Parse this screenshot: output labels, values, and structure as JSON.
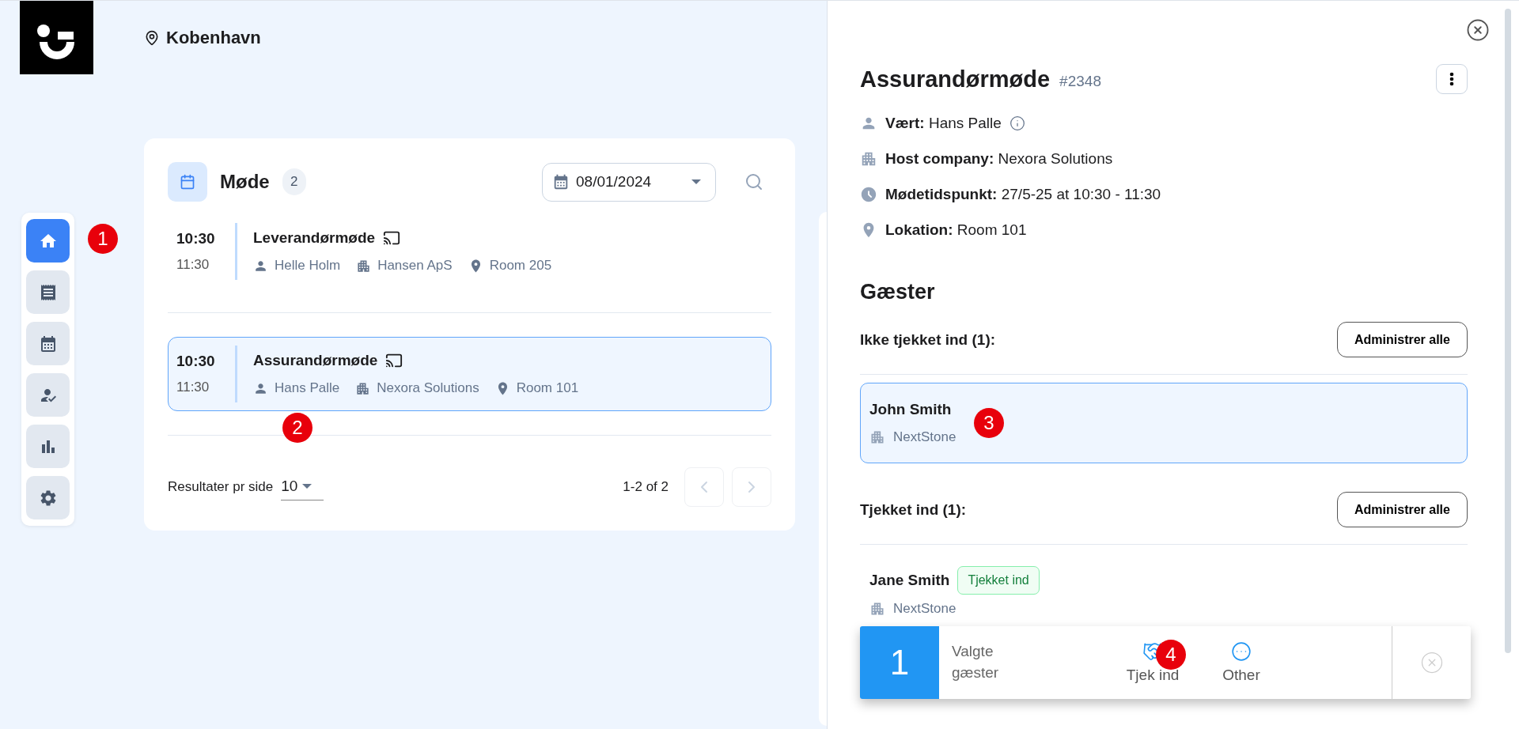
{
  "header": {
    "location": "Kobenhavn"
  },
  "nav": [
    {
      "kind": "home",
      "selected": true
    },
    {
      "kind": "receipt",
      "selected": false
    },
    {
      "kind": "calendar",
      "selected": false
    },
    {
      "kind": "visitor",
      "selected": false
    },
    {
      "kind": "stats",
      "selected": false
    },
    {
      "kind": "settings",
      "selected": false
    }
  ],
  "meetings": {
    "title": "Møde",
    "count": "2",
    "date": "08/01/2024",
    "rows": [
      {
        "start": "10:30",
        "end": "11:30",
        "title": "Leverandørmøde",
        "host": "Helle Holm",
        "company": "Hansen ApS",
        "room": "Room 205",
        "selected": false
      },
      {
        "start": "10:30",
        "end": "11:30",
        "title": "Assurandørmøde",
        "host": "Hans Palle",
        "company": "Nexora Solutions",
        "room": "Room 101",
        "selected": true
      }
    ],
    "page_size_label": "Resultater pr side",
    "page_size": "10",
    "range": "1-2 of 2"
  },
  "detail": {
    "title": "Assurandørmøde",
    "number": "#2348",
    "fields": [
      {
        "kind": "host",
        "label": "Vært:",
        "value": "Hans Palle"
      },
      {
        "kind": "company",
        "label": "Host company:",
        "value": "Nexora Solutions"
      },
      {
        "kind": "time",
        "label": "Mødetidspunkt:",
        "value": "27/5-25 at 10:30 - 11:30"
      },
      {
        "kind": "location",
        "label": "Lokation:",
        "value": "Room 101"
      }
    ],
    "guests_heading": "Gæster",
    "groups": [
      {
        "heading": "Ikke tjekket ind (1):",
        "button": "Administrer alle",
        "guests": [
          {
            "name": "John Smith",
            "company": "NextStone",
            "selected": true
          }
        ]
      },
      {
        "heading": "Tjekket ind (1):",
        "button": "Administrer alle",
        "guests": [
          {
            "name": "Jane Smith",
            "company": "NextStone",
            "selected": false,
            "status": "Tjekket ind"
          }
        ]
      }
    ]
  },
  "action_bar": {
    "count": "1",
    "label": "Valgte gæster",
    "actions": [
      {
        "kind": "checkin",
        "label": "Tjek ind"
      },
      {
        "kind": "other",
        "label": "Other"
      }
    ]
  },
  "annotations": [
    "1",
    "2",
    "3",
    "4"
  ]
}
